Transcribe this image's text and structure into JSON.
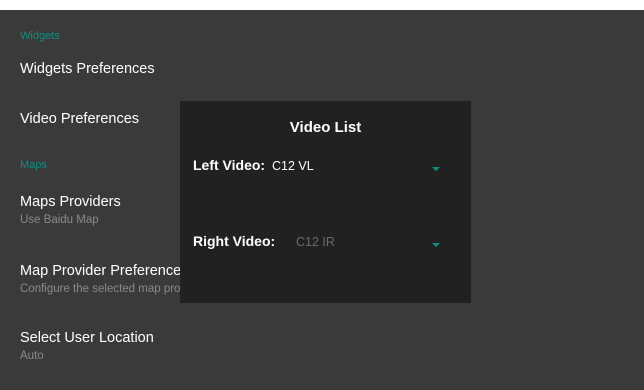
{
  "settings": {
    "widgets_category": "Widgets",
    "widgets_preferences": "Widgets Preferences",
    "video_preferences": "Video Preferences",
    "maps_category": "Maps",
    "maps_providers": "Maps Providers",
    "maps_providers_summary": "Use Baidu Map",
    "map_provider_preferences": "Map Provider Preferences",
    "map_provider_preferences_summary": "Configure the selected map provider",
    "select_user_location": "Select User Location",
    "select_user_location_summary": "Auto"
  },
  "dialog": {
    "title": "Video List",
    "left_label": "Left Video:",
    "left_value": "C12 VL",
    "right_label": "Right Video:",
    "right_value": "C12 IR"
  },
  "colors": {
    "accent": "#0e8f82",
    "background": "#3a3a3a",
    "dialog": "#212121"
  }
}
